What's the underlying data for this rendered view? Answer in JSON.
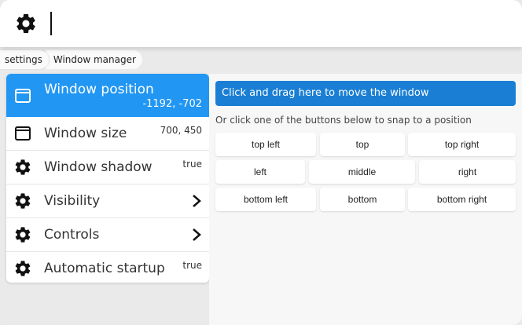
{
  "breadcrumb": [
    "settings",
    "Window manager"
  ],
  "menu": [
    {
      "label": "Window position",
      "value": "-1192, -702",
      "icon": "window-icon",
      "active": true
    },
    {
      "label": "Window size",
      "value": "700, 450",
      "icon": "window-icon"
    },
    {
      "label": "Window shadow",
      "value": "true",
      "icon": "gear-icon"
    },
    {
      "label": "Visibility",
      "value": "",
      "icon": "gear-icon",
      "chevron": true
    },
    {
      "label": "Controls",
      "value": "",
      "icon": "gear-icon",
      "chevron": true
    },
    {
      "label": "Automatic startup",
      "value": "true",
      "icon": "gear-icon"
    }
  ],
  "right": {
    "drag_label": "Click and drag here to move the window",
    "hint": "Or click one of the buttons below to snap to a position",
    "buttons": {
      "top_left": "top left",
      "top": "top",
      "top_right": "top right",
      "left": "left",
      "middle": "middle",
      "right": "right",
      "bottom_left": "bottom left",
      "bottom": "bottom",
      "bottom_right": "bottom right"
    }
  },
  "colors": {
    "accent": "#2196f3",
    "drag_bar": "#1a7fd4"
  }
}
